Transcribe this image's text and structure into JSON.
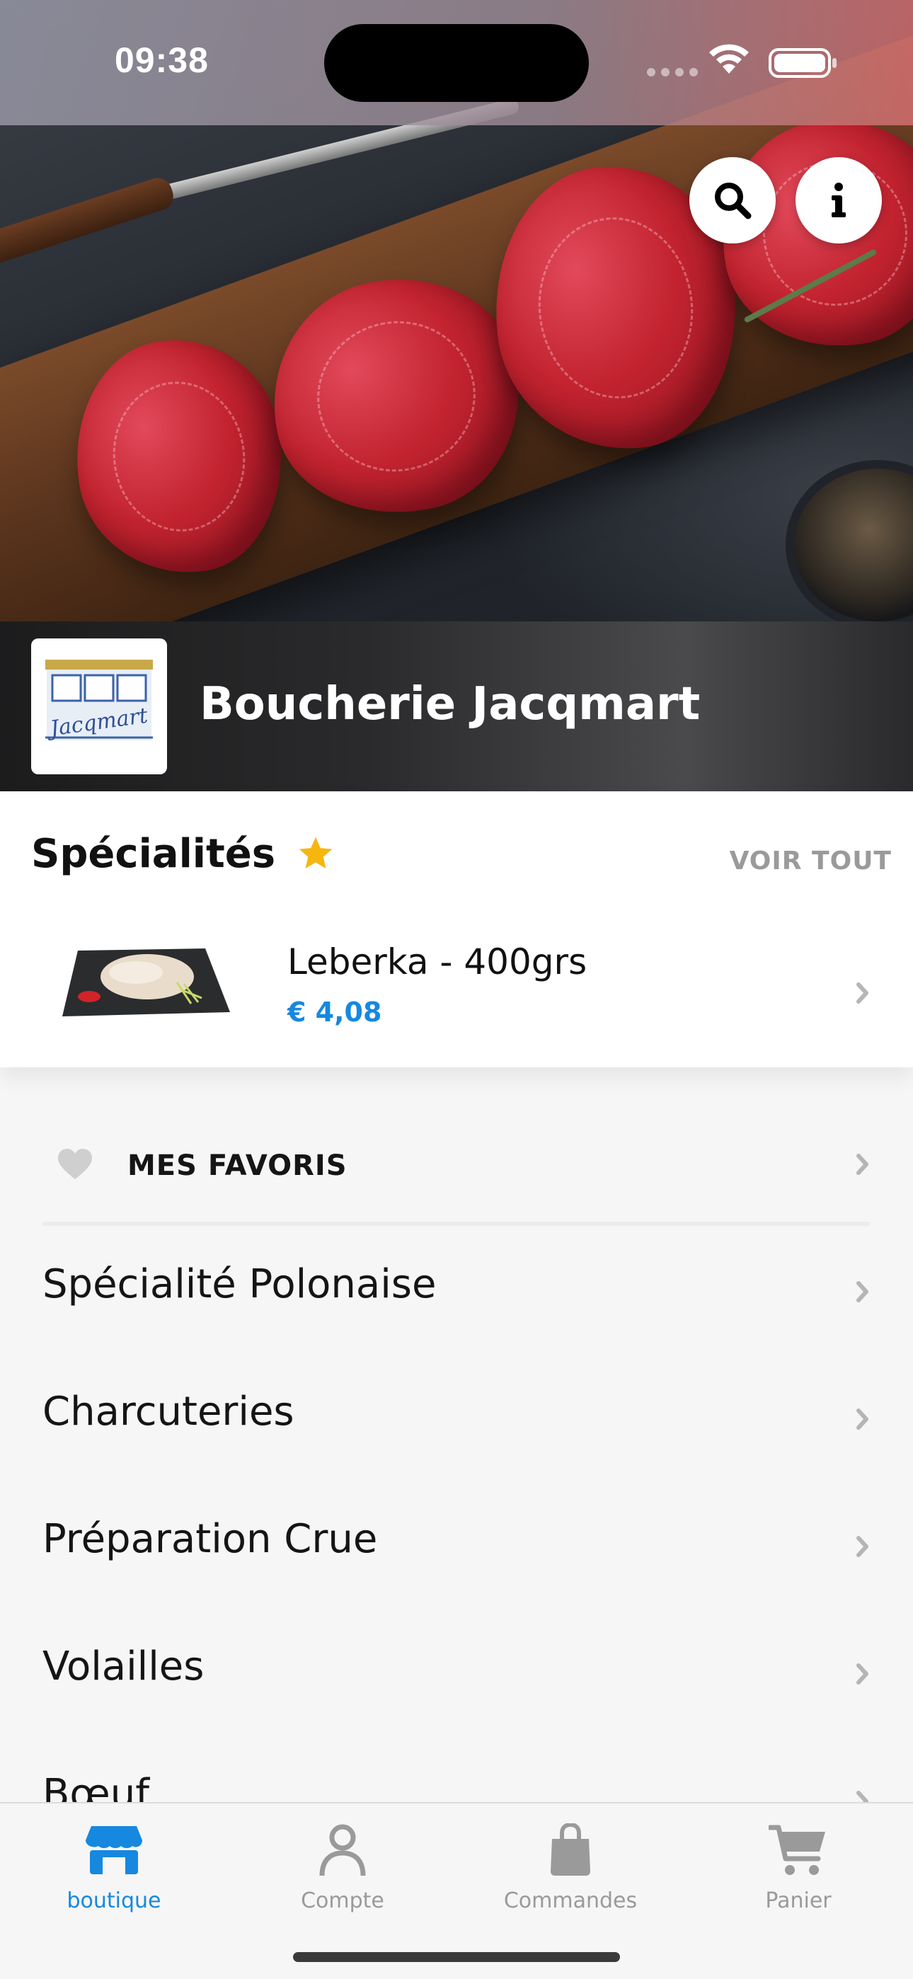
{
  "status_bar": {
    "time": "09:38"
  },
  "hero": {
    "store_name": "Boucherie Jacqmart",
    "logo_text": "Jacqmart"
  },
  "specialites": {
    "title": "Spécialités",
    "see_all": "VOIR TOUT",
    "products": [
      {
        "name": "Leberka - 400grs",
        "price": "€ 4,08"
      }
    ]
  },
  "favorites": {
    "label": "MES FAVORIS"
  },
  "categories": [
    {
      "label": "Spécialité Polonaise"
    },
    {
      "label": "Charcuteries"
    },
    {
      "label": "Préparation Crue"
    },
    {
      "label": "Volailles"
    },
    {
      "label": "Bœuf"
    }
  ],
  "tab_bar": {
    "tabs": [
      {
        "label": "boutique",
        "icon": "store-icon",
        "active": true
      },
      {
        "label": "Compte",
        "icon": "person-icon",
        "active": false
      },
      {
        "label": "Commandes",
        "icon": "bag-icon",
        "active": false
      },
      {
        "label": "Panier",
        "icon": "cart-icon",
        "active": false
      }
    ]
  },
  "colors": {
    "accent": "#1688e0",
    "star": "#f5b70f",
    "muted": "#9a9a9a"
  }
}
